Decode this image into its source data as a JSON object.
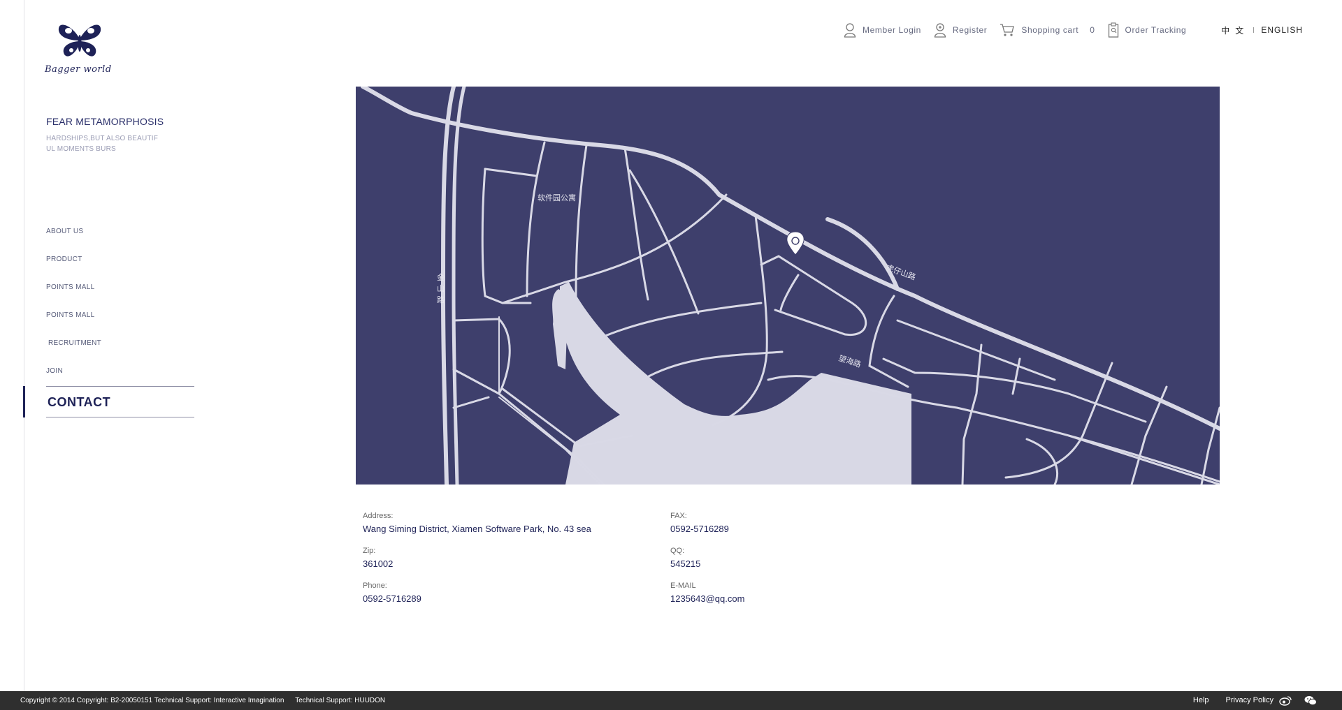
{
  "brand": {
    "logo_text": "Bagger world"
  },
  "tagline": {
    "title": "FEAR METAMORPHOSIS",
    "subtitle_line1": "HARDSHIPS,BUT ALSO BEAUTIF",
    "subtitle_line2": "UL MOMENTS BURS"
  },
  "nav": {
    "items": [
      {
        "label": "ABOUT US"
      },
      {
        "label": "PRODUCT"
      },
      {
        "label": "POINTS MALL"
      },
      {
        "label": "POINTS MALL"
      },
      {
        "label": "RECRUITMENT"
      },
      {
        "label": "JOIN"
      }
    ],
    "active": "CONTACT"
  },
  "topbar": {
    "member_login": "Member Login",
    "register": "Register",
    "shopping_cart": "Shopping cart",
    "cart_count": "0",
    "order_tracking": "Order Tracking",
    "lang_zh": "中文",
    "lang_en": "ENGLISH"
  },
  "map": {
    "labels": {
      "park_road": "软件园公寓",
      "jinshan_1": "金",
      "jinshan_2": "山",
      "jinshan_3": "路",
      "huzi_road": "虎仔山路",
      "wanghai_road": "望海路"
    },
    "colors": {
      "background": "#3e3f6c",
      "road": "#d9d9e6",
      "water": "#d8d8e5"
    }
  },
  "contact": {
    "address_label": "Address:",
    "address": "Wang Siming District, Xiamen Software Park, No. 43 sea",
    "zip_label": "Zip:",
    "zip": "361002",
    "phone_label": "Phone:",
    "phone": "0592-5716289",
    "fax_label": "FAX:",
    "fax": "0592-5716289",
    "qq_label": "QQ:",
    "qq": "545215",
    "email_label": "E-MAIL",
    "email": "1235643@qq.com"
  },
  "footer": {
    "copyright": "Copyright © 2014 Copyright: B2-20050151 Technical Support: Interactive Imagination",
    "support": "Technical Support: HUUDON",
    "help": "Help",
    "privacy": "Privacy Policy",
    "icons": [
      "weibo-icon",
      "wechat-icon"
    ]
  }
}
